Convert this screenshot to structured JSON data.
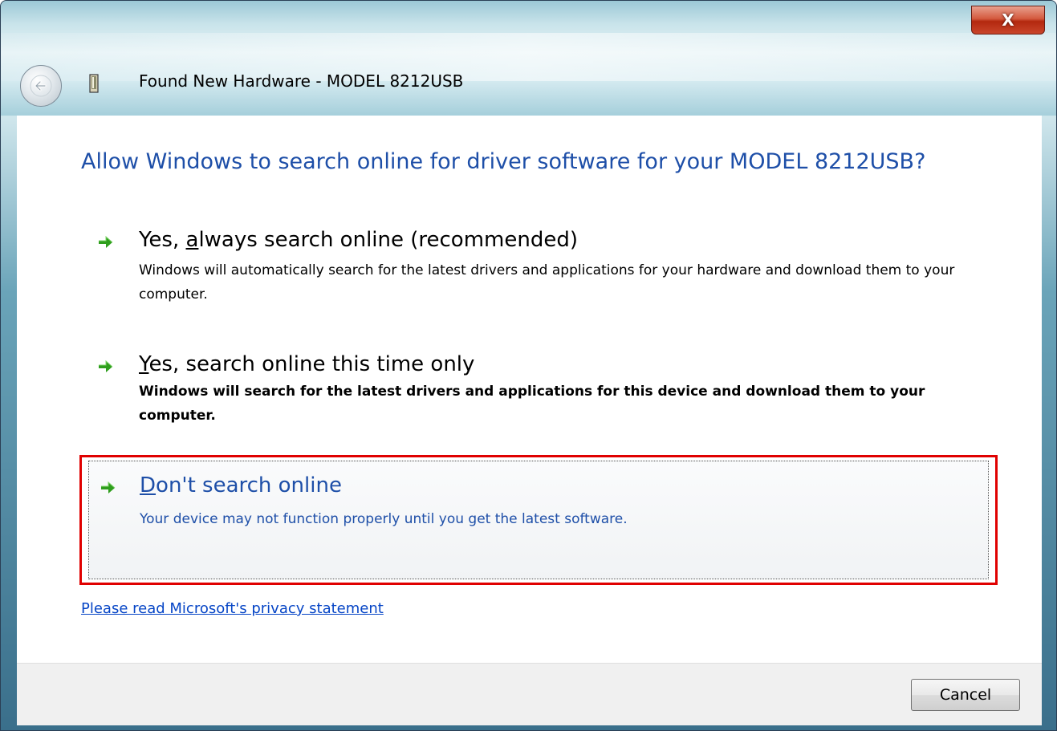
{
  "window": {
    "title": "Found New Hardware - MODEL 8212USB",
    "close_label": "X"
  },
  "heading": "Allow Windows to search online for driver software for your MODEL 8212USB?",
  "options": [
    {
      "title_prefix": "Yes, ",
      "title_mnemonic": "a",
      "title_rest": "lways search online (recommended)",
      "description": "Windows will automatically search for the latest drivers and applications for your hardware and download them to your computer.",
      "selected": false
    },
    {
      "title_prefix": "",
      "title_mnemonic": "Y",
      "title_rest": "es, search online this time only",
      "description": "Windows will search for the latest drivers and applications for this device and download them to your computer.",
      "selected": false
    },
    {
      "title_prefix": "",
      "title_mnemonic": "D",
      "title_rest": "on't search online",
      "description": "Your device may not function properly until you get the latest software.",
      "selected": true
    }
  ],
  "privacy_link": "Please read Microsoft's  privacy statement",
  "footer": {
    "cancel_label": "Cancel"
  },
  "colors": {
    "heading": "#1e4fa8",
    "selected_text": "#1e4fa8",
    "highlight_border": "#e00000",
    "arrow_green": "#2f9e1d",
    "link": "#0645c6"
  }
}
